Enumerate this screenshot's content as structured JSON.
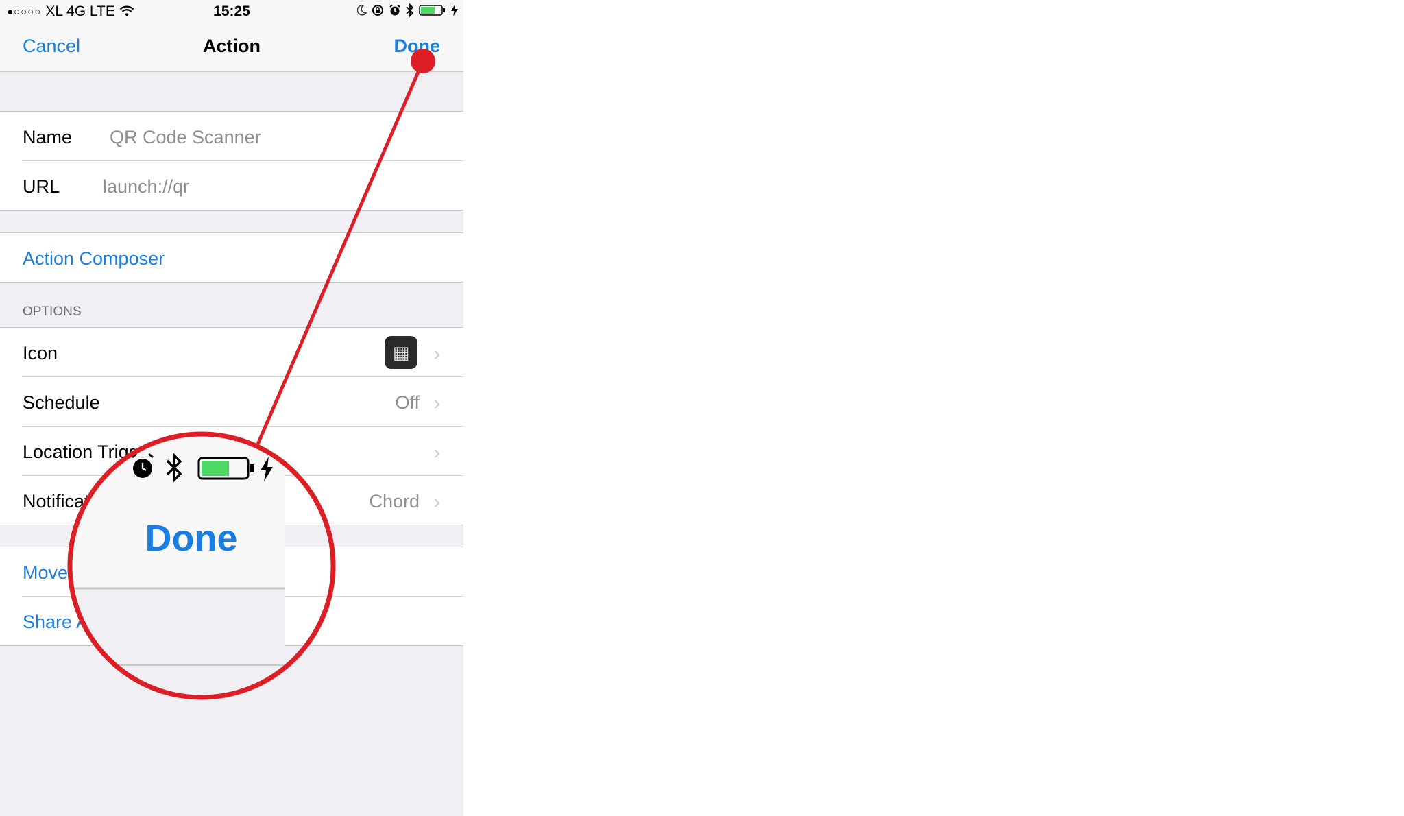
{
  "status_bar": {
    "signal": "●○○○○",
    "carrier": "XL 4G LTE",
    "time": "15:25"
  },
  "navbar": {
    "cancel_label": "Cancel",
    "title": "Action",
    "done_label": "Done"
  },
  "form": {
    "name_label": "Name",
    "name_value": "QR Code Scanner",
    "url_label": "URL",
    "url_value": "launch://qr"
  },
  "composer": {
    "label": "Action Composer"
  },
  "options": {
    "header": "OPTIONS",
    "icon_label": "Icon",
    "schedule_label": "Schedule",
    "schedule_value": "Off",
    "location_label": "Location Trigger",
    "notification_label": "Notification Sound",
    "notification_value": "Chord"
  },
  "actions": {
    "move_label": "Move",
    "share_label": "Share Action"
  },
  "zoom_callout": {
    "done_label": "Done",
    "highlight_color": "#dc1f26"
  },
  "colors": {
    "ios_blue": "#1a7ee0",
    "group_background": "#efeff4",
    "battery_green": "#4cd964"
  }
}
